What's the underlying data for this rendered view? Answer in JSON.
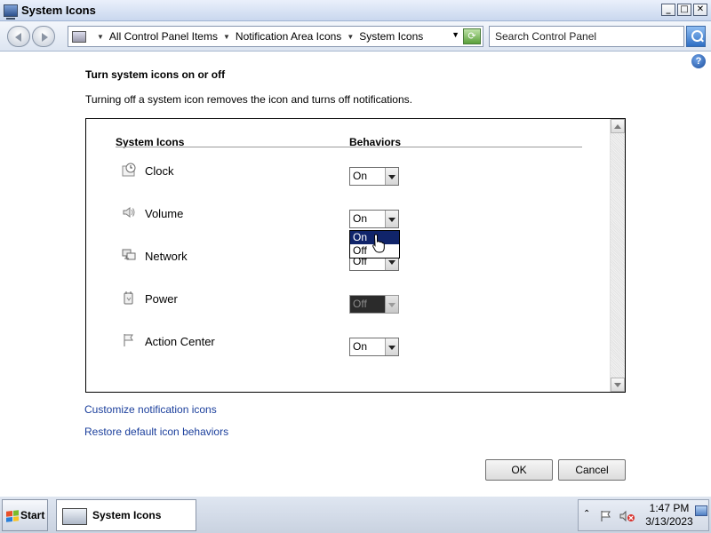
{
  "window": {
    "title": "System Icons",
    "controls": {
      "minimize": "_",
      "maximize": "□",
      "close": "✕"
    }
  },
  "address": {
    "crumbs": [
      "All Control Panel Items",
      "Notification Area Icons",
      "System Icons"
    ],
    "search_placeholder": "Search Control Panel"
  },
  "help": {
    "glyph": "?"
  },
  "main": {
    "heading": "Turn system icons on or off",
    "description": "Turning off a system icon removes the icon and turns off notifications.",
    "table": {
      "col_icons": "System Icons",
      "col_behaviors": "Behaviors",
      "rows": [
        {
          "label": "Clock",
          "icon": "clock-icon",
          "behavior": "On",
          "disabled": false
        },
        {
          "label": "Volume",
          "icon": "volume-icon",
          "behavior": "On",
          "disabled": false
        },
        {
          "label": "Network",
          "icon": "network-icon",
          "behavior": "Off",
          "disabled": false
        },
        {
          "label": "Power",
          "icon": "power-icon",
          "behavior": "Off",
          "disabled": true
        },
        {
          "label": "Action Center",
          "icon": "flag-icon",
          "behavior": "On",
          "disabled": false
        }
      ],
      "open_dropdown": {
        "options": [
          "On",
          "Off"
        ],
        "highlighted": "On"
      }
    },
    "links": {
      "customize": "Customize notification icons",
      "restore": "Restore default icon behaviors"
    },
    "buttons": {
      "ok": "OK",
      "cancel": "Cancel"
    }
  },
  "taskbar": {
    "start_label": "Start",
    "task_label": "System Icons",
    "tray_chevron": "⌃",
    "time": "1:47 PM",
    "date": "3/13/2023"
  },
  "colors": {
    "selection": "#10246a",
    "link": "#1b3f9c",
    "start_logo": [
      "#e8502b",
      "#7bbb2c",
      "#2a7fd8",
      "#f7c325"
    ]
  }
}
